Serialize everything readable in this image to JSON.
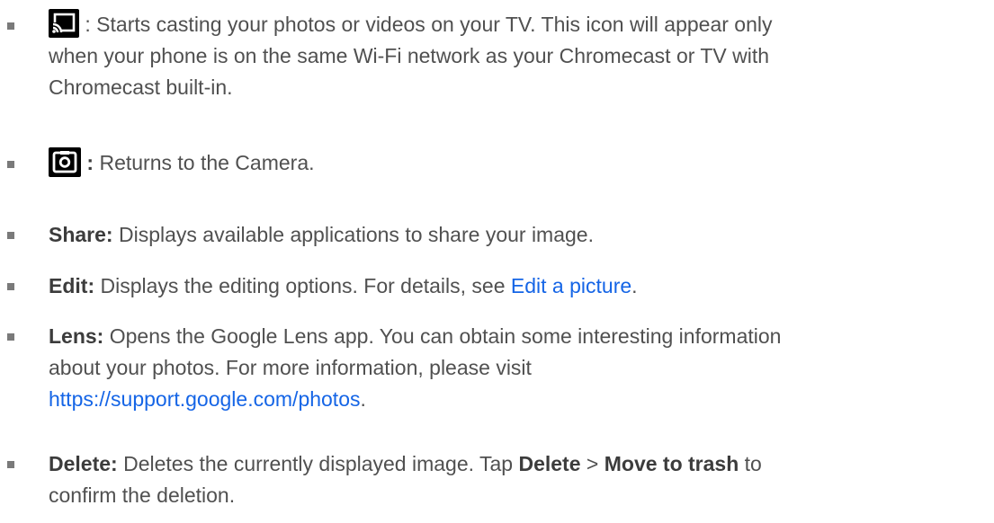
{
  "items": [
    {
      "icon": "cast-icon",
      "lines": [
        " : Starts casting your photos or videos on your TV. This icon will appear only",
        "when your phone is on the same Wi-Fi network as your Chromecast or TV with",
        "Chromecast built-in."
      ]
    },
    {
      "icon": "camera-icon",
      "colon": " :",
      "text": " Returns to the Camera."
    },
    {
      "label": "Share:",
      "text": " Displays available applications to share your image."
    },
    {
      "label": "Edit:",
      "text": " Displays the editing options. For details, see ",
      "link": "Edit a picture",
      "end": "."
    },
    {
      "label": "Lens:",
      "line1": " Opens the Google Lens app. You can obtain some interesting information",
      "line2": "about your photos. For more information, please visit",
      "link": "https://support.google.com/photos",
      "end": "."
    },
    {
      "label": "Delete:",
      "text1": " Deletes the currently displayed image. Tap ",
      "bold1": "Delete",
      "sep": " > ",
      "bold2": "Move to trash",
      "text2": " to",
      "line2": "confirm the deletion."
    }
  ],
  "colors": {
    "text": "#505050",
    "link": "#1565e6",
    "bullet": "#7a7a7a"
  }
}
